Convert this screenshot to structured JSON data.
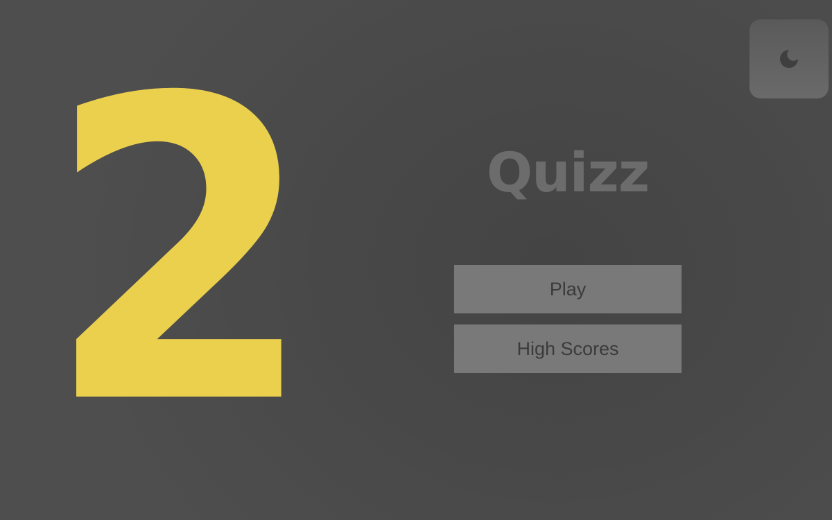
{
  "countdown": {
    "value": "2"
  },
  "theme_toggle": {
    "icon": "moon-icon"
  },
  "title": "Quizz",
  "menu": {
    "play_label": "Play",
    "high_scores_label": "High Scores"
  },
  "colors": {
    "countdown": "#ebd04e",
    "title": "#6c6c6c",
    "button_bg": "#797979",
    "button_text": "#3b3b3b",
    "toggle_icon": "#3f3f3f"
  }
}
